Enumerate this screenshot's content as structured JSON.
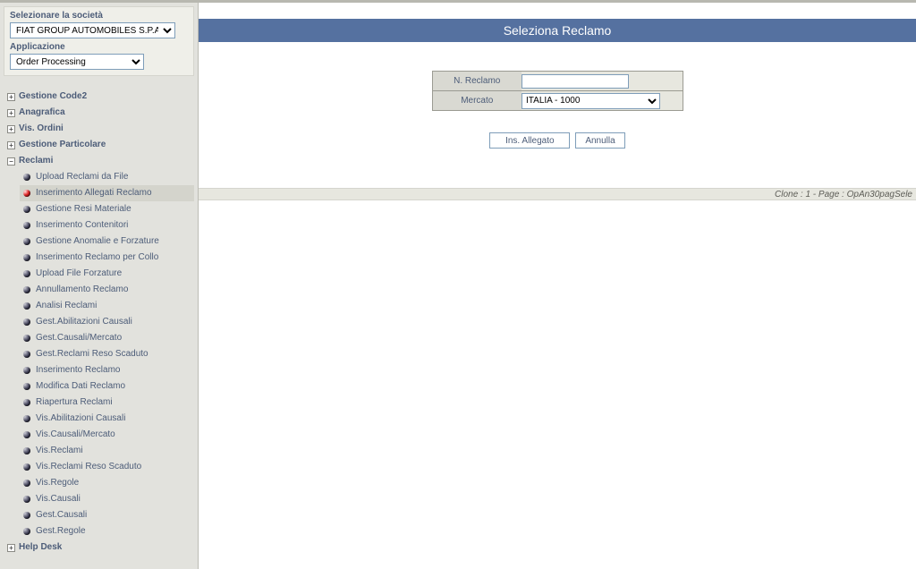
{
  "sidebar": {
    "company_label": "Selezionare la società",
    "company_value": "FIAT GROUP AUTOMOBILES S.P.A",
    "app_label": "Applicazione",
    "app_value": "Order Processing",
    "top_nodes": [
      {
        "label": "Gestione Code2",
        "expanded": false
      },
      {
        "label": "Anagrafica",
        "expanded": false
      },
      {
        "label": "Vis. Ordini",
        "expanded": false
      },
      {
        "label": "Gestione Particolare",
        "expanded": false
      },
      {
        "label": "Reclami",
        "expanded": true
      }
    ],
    "reclami_items": [
      {
        "label": "Upload Reclami da File",
        "active": false,
        "selected": false
      },
      {
        "label": "Inserimento Allegati Reclamo",
        "active": true,
        "selected": true
      },
      {
        "label": "Gestione Resi Materiale",
        "active": false,
        "selected": false
      },
      {
        "label": "Inserimento Contenitori",
        "active": false,
        "selected": false
      },
      {
        "label": "Gestione Anomalie e Forzature",
        "active": false,
        "selected": false
      },
      {
        "label": "Inserimento Reclamo per Collo",
        "active": false,
        "selected": false
      },
      {
        "label": "Upload File Forzature",
        "active": false,
        "selected": false
      },
      {
        "label": "Annullamento Reclamo",
        "active": false,
        "selected": false
      },
      {
        "label": "Analisi Reclami",
        "active": false,
        "selected": false
      },
      {
        "label": "Gest.Abilitazioni Causali",
        "active": false,
        "selected": false
      },
      {
        "label": "Gest.Causali/Mercato",
        "active": false,
        "selected": false
      },
      {
        "label": "Gest.Reclami Reso Scaduto",
        "active": false,
        "selected": false
      },
      {
        "label": "Inserimento Reclamo",
        "active": false,
        "selected": false
      },
      {
        "label": "Modifica Dati Reclamo",
        "active": false,
        "selected": false
      },
      {
        "label": "Riapertura Reclami",
        "active": false,
        "selected": false
      },
      {
        "label": "Vis.Abilitazioni Causali",
        "active": false,
        "selected": false
      },
      {
        "label": "Vis.Causali/Mercato",
        "active": false,
        "selected": false
      },
      {
        "label": "Vis.Reclami",
        "active": false,
        "selected": false
      },
      {
        "label": "Vis.Reclami Reso Scaduto",
        "active": false,
        "selected": false
      },
      {
        "label": "Vis.Regole",
        "active": false,
        "selected": false
      },
      {
        "label": "Vis.Causali",
        "active": false,
        "selected": false
      },
      {
        "label": "Gest.Causali",
        "active": false,
        "selected": false
      },
      {
        "label": "Gest.Regole",
        "active": false,
        "selected": false
      }
    ],
    "helpdesk_label": "Help Desk"
  },
  "main": {
    "title": "Seleziona Reclamo",
    "form": {
      "n_reclamo_label": "N. Reclamo",
      "n_reclamo_value": "",
      "mercato_label": "Mercato",
      "mercato_value": "ITALIA - 1000"
    },
    "buttons": {
      "ins_allegato": "Ins. Allegato",
      "annulla": "Annulla"
    },
    "footer": "Clone : 1 - Page : OpAn30pagSele"
  }
}
